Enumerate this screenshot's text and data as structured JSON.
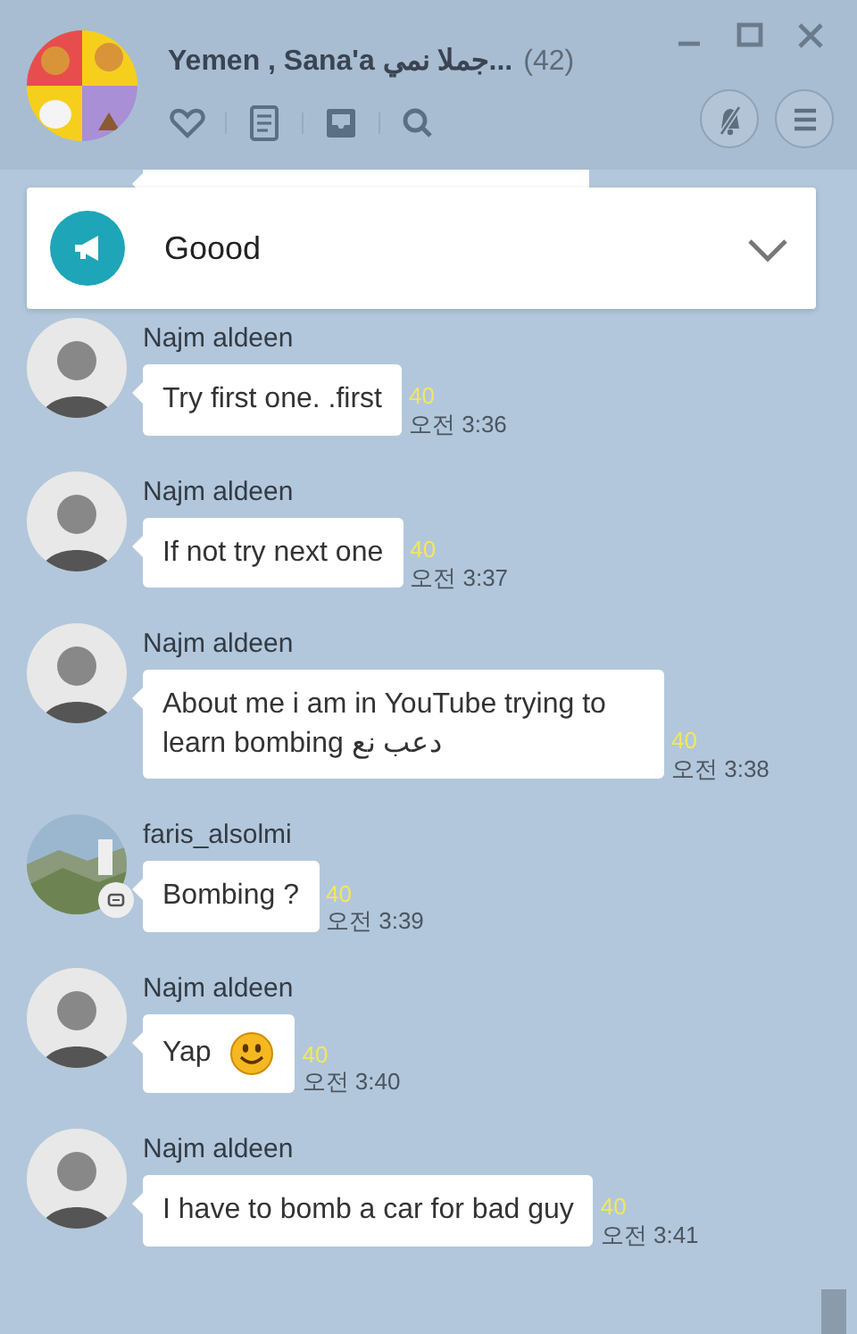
{
  "window": {
    "title": "Yemen , Sana'a جملا نمي...",
    "member_count": "(42)"
  },
  "notice": {
    "text": "Goood",
    "expanded": false
  },
  "messages": [
    {
      "kind": "partial"
    },
    {
      "kind": "message",
      "sender": "Najm aldeen",
      "avatar": {
        "kind": "person"
      },
      "text": "Try first one. .first",
      "unread": "40",
      "time": "오전 3:36"
    },
    {
      "kind": "message",
      "sender": "Najm aldeen",
      "avatar": {
        "kind": "person"
      },
      "text": "If not try next one",
      "unread": "40",
      "time": "오전 3:37"
    },
    {
      "kind": "message",
      "sender": "Najm aldeen",
      "avatar": {
        "kind": "person"
      },
      "text": "About me i am in YouTube trying to learn bombing دعب نع",
      "unread": "40",
      "time": "오전 3:38"
    },
    {
      "kind": "message",
      "sender": "faris_alsolmi",
      "text": "Bombing ?",
      "unread": "40",
      "time": "오전 3:39"
    },
    {
      "kind": "emoji_message",
      "sender": "Najm aldeen",
      "avatar": {
        "kind": "person"
      },
      "text": "Yap",
      "unread": "40",
      "time": "오전 3:40"
    },
    {
      "kind": "message",
      "sender": "Najm aldeen",
      "avatar": {
        "kind": "person"
      },
      "text": "I have to bomb a car for bad guy",
      "unread": "40",
      "time": "오전 3:41"
    }
  ]
}
